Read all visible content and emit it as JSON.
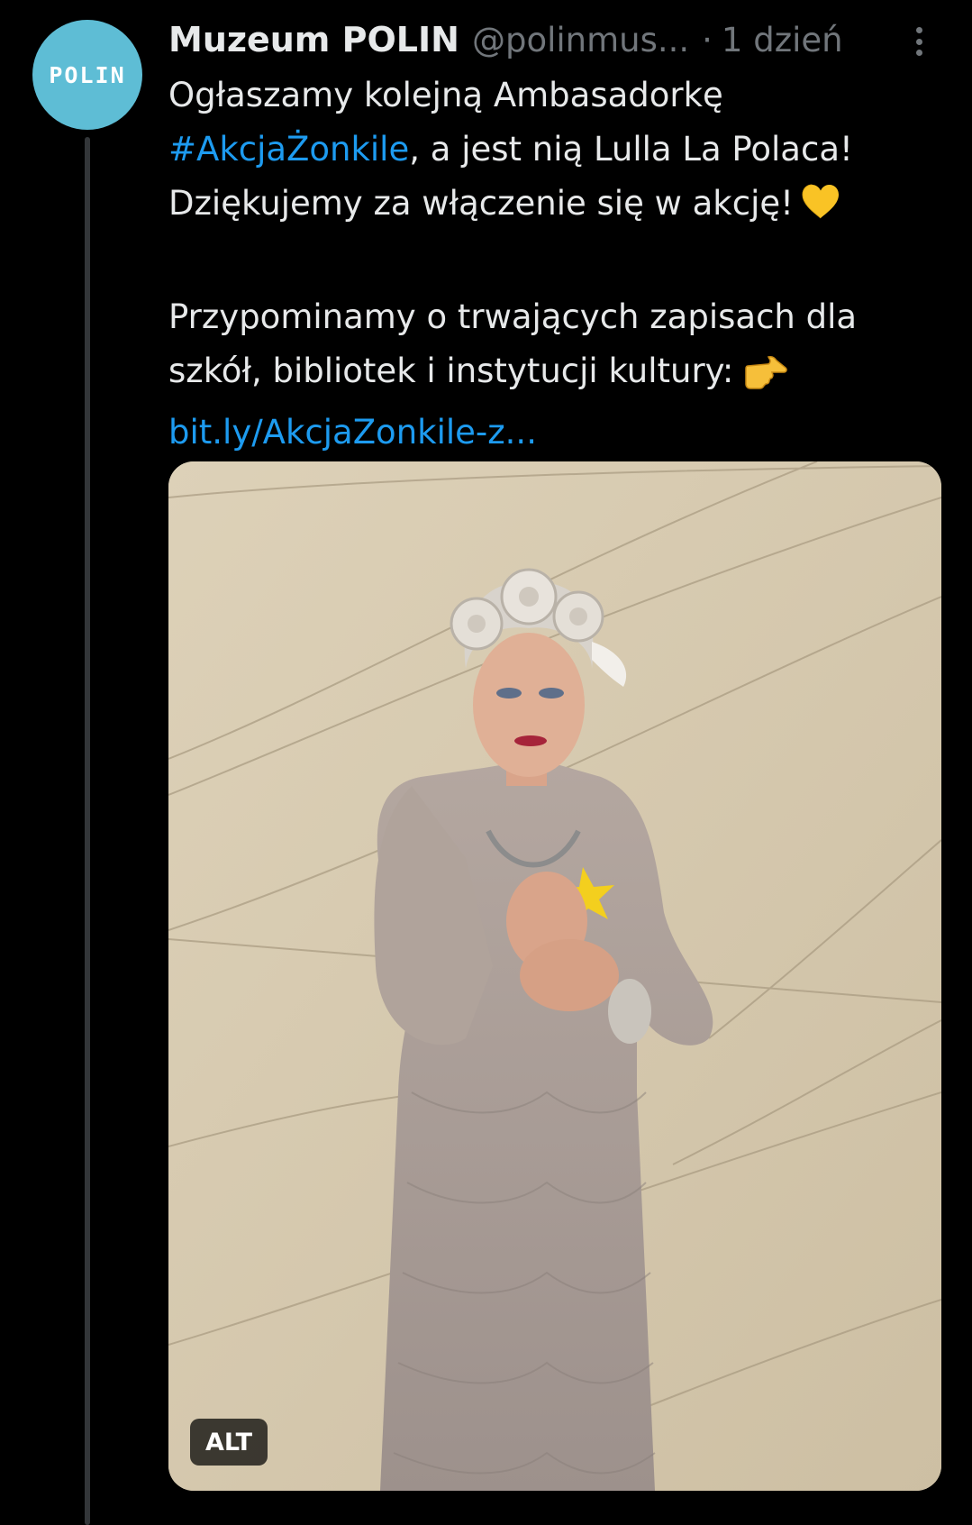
{
  "tweet": {
    "author": {
      "display_name": "Muzeum POLIN",
      "handle": "@polinmus...",
      "avatar_text": "POLIN"
    },
    "separator": "·",
    "timestamp": "1 dzień",
    "text": {
      "line1": "Ogłaszamy kolejną Ambasadorkę",
      "line2_hashtag": "#AkcjaŻonkile",
      "line2_rest": ", a jest nią Lulla La Polaca!",
      "line3": "Dziękujemy za włączenie się w akcję!",
      "line4": "Przypominamy o trwających zapisach dla",
      "line5": "szkół, bibliotek i instytucji kultury:",
      "link": "bit.ly/AkcjaZonkile-z..."
    },
    "emojis": {
      "heart": "yellow-heart-icon",
      "hand": "pointing-right-icon"
    },
    "media": {
      "alt_label": "ALT"
    }
  },
  "colors": {
    "background": "#000000",
    "text": "#e7e9ea",
    "secondary": "#71767b",
    "link": "#1d9bf0",
    "avatar": "#5ebdd5",
    "thread_line": "#333639"
  }
}
